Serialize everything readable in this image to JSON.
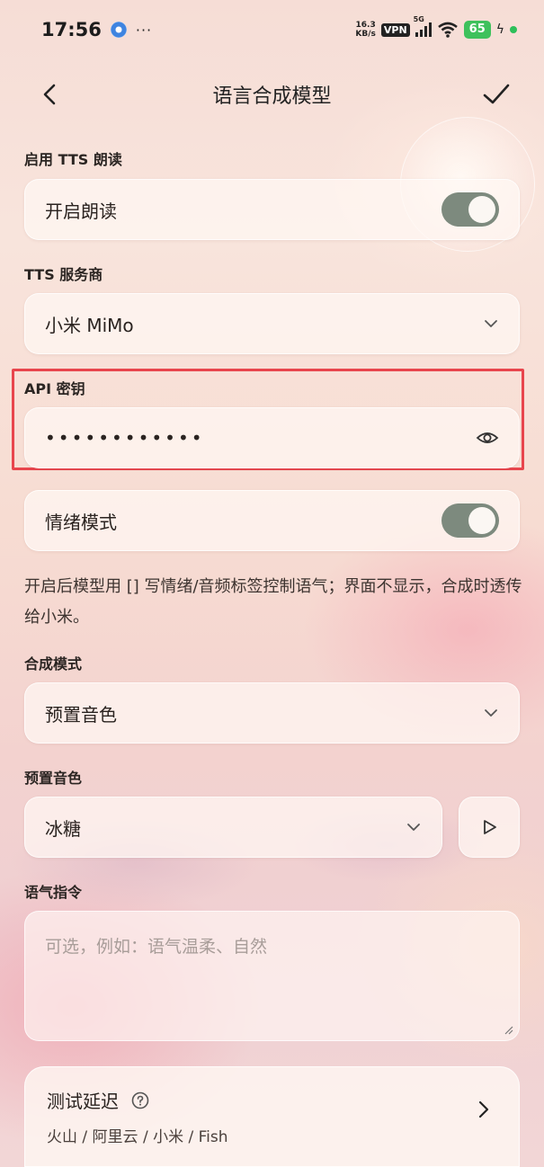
{
  "status_bar": {
    "time": "17:56",
    "dots": "···",
    "net_speed_value": "16.3",
    "net_speed_unit": "KB/s",
    "vpn": "VPN",
    "signal_tag": "5G",
    "battery": "65"
  },
  "nav": {
    "title": "语言合成模型",
    "back_icon": "chevron-left-icon",
    "confirm_icon": "check-icon"
  },
  "tts_enable": {
    "label": "启用 TTS 朗读",
    "item_text": "开启朗读",
    "toggle_on": true
  },
  "provider": {
    "label": "TTS 服务商",
    "value": "小米 MiMo"
  },
  "api_key": {
    "label": "API 密钥",
    "masked_value": "••••••••••••"
  },
  "emotion": {
    "item_text": "情绪模式",
    "toggle_on": true,
    "hint": "开启后模型用 [] 写情绪/音频标签控制语气；界面不显示，合成时透传给小米。"
  },
  "synthesis_mode": {
    "label": "合成模式",
    "value": "预置音色"
  },
  "preset_voice": {
    "label": "预置音色",
    "value": "冰糖"
  },
  "tone_instruction": {
    "label": "语气指令",
    "placeholder": "可选，例如：语气温柔、自然"
  },
  "latency_test": {
    "title": "测试延迟",
    "subtitle": "火山 / 阿里云 / 小米 / Fish"
  },
  "colors": {
    "toggle_track": "#7d8a7e",
    "highlight_border": "#e8454d",
    "battery": "#3ec15c"
  }
}
